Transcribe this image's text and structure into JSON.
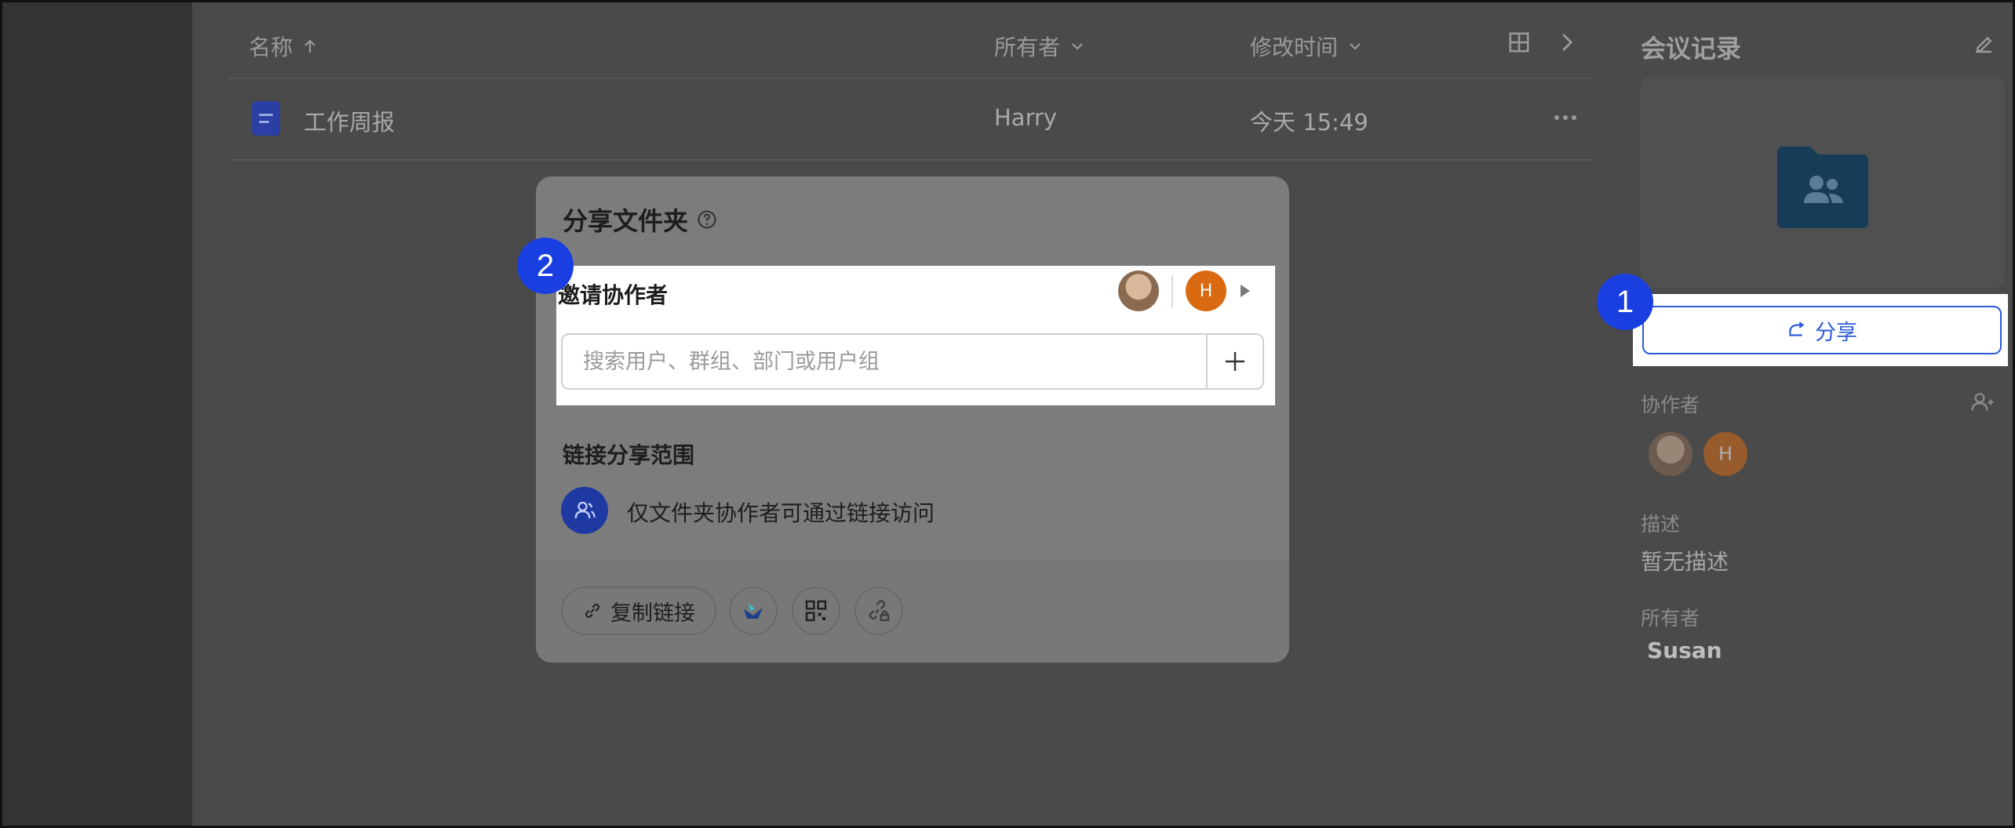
{
  "file_list": {
    "columns": {
      "name": "名称",
      "owner": "所有者",
      "modified": "修改时间"
    },
    "rows": [
      {
        "name": "工作周报",
        "owner": "Harry",
        "modified": "今天 15:49"
      }
    ]
  },
  "right_panel": {
    "title": "会议记录",
    "share_button": "分享",
    "collaborators_label": "协作者",
    "description_label": "描述",
    "description_value": "暂无描述",
    "owner_label": "所有者",
    "owner_value": "Susan",
    "avatar_h": "H"
  },
  "modal": {
    "title": "分享文件夹",
    "invite_title": "邀请协作者",
    "invite_avatar_h": "H",
    "search_placeholder": "搜索用户、群组、部门或用户组",
    "scope_title": "链接分享范围",
    "scope_text": "仅文件夹协作者可通过链接访问",
    "copy_link": "复制链接"
  },
  "badges": {
    "one": "1",
    "two": "2"
  },
  "colors": {
    "accent": "#2a5bd7",
    "badge": "#1a3fe0",
    "avatar_orange": "#d96a12",
    "doc_icon": "#2b3ea3"
  }
}
